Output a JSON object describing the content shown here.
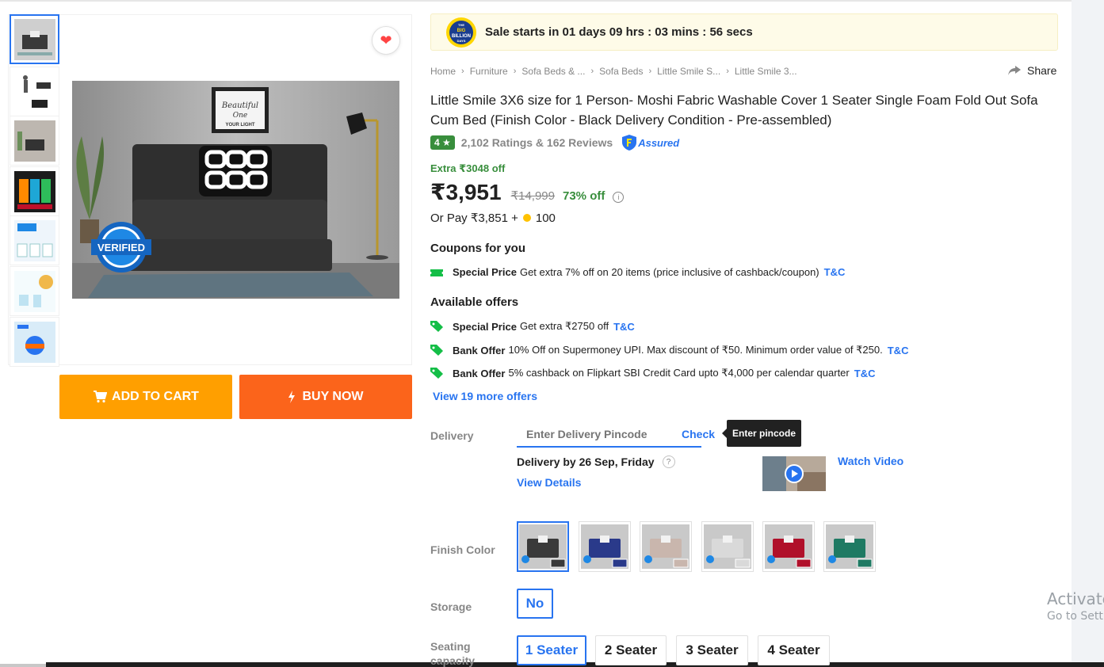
{
  "sale_banner": {
    "text": "Sale starts in 01 days 09 hrs : 03 mins : 56 secs",
    "badge_text": "BIG BILLION DAYS",
    "badge_top": "THE",
    "badge_main": "BIG",
    "badge_sub": "BILLION",
    "badge_bottom": "DAYS"
  },
  "breadcrumbs": [
    "Home",
    "Furniture",
    "Sofa Beds & ...",
    "Sofa Beds",
    "Little Smile S...",
    "Little Smile 3..."
  ],
  "share_label": "Share",
  "product": {
    "title": "Little Smile 3X6 size for 1 Person- Moshi Fabric Washable Cover 1 Seater Single Foam Fold Out Sofa Cum Bed  (Finish Color - Black Delivery Condition - Pre-assembled)",
    "rating": "4 ★",
    "ratings_reviews": "2,102 Ratings & 162 Reviews",
    "assured_label": "Assured",
    "extra_off": "Extra ₹3048 off",
    "price": "₹3,951",
    "mrp": "₹14,999",
    "discount": "73% off",
    "or_pay_prefix": "Or Pay ₹3,851 +",
    "or_pay_coins": "100",
    "image_alt_text": "VERIFIED",
    "image_frame_line1": "Beautiful",
    "image_frame_line2": "One",
    "image_frame_line3": "YOUR LIGHT"
  },
  "coupons": {
    "title": "Coupons for you",
    "items": [
      {
        "type": "Special Price",
        "text": "Get extra 7% off on 20 items (price inclusive of cashback/coupon)",
        "link": "T&C"
      }
    ]
  },
  "offers": {
    "title": "Available offers",
    "items": [
      {
        "type": "Special Price",
        "text": "Get extra ₹2750 off",
        "link": "T&C"
      },
      {
        "type": "Bank Offer",
        "text": "10% Off on Supermoney UPI. Max discount of ₹50. Minimum order value of ₹250.",
        "link": "T&C"
      },
      {
        "type": "Bank Offer",
        "text": "5% cashback on Flipkart SBI Credit Card upto ₹4,000 per calendar quarter",
        "link": "T&C"
      }
    ],
    "more_link": "View 19 more offers"
  },
  "delivery": {
    "label": "Delivery",
    "pincode_placeholder": "Enter Delivery Pincode",
    "check_label": "Check",
    "tooltip": "Enter pincode",
    "date_text": "Delivery by 26 Sep, Friday",
    "help_glyph": "?",
    "view_details": "View Details",
    "watch_video": "Watch Video"
  },
  "finish_color": {
    "label": "Finish Color",
    "swatches": [
      {
        "name": "Black",
        "color": "#3a3a3a"
      },
      {
        "name": "Blue",
        "color": "#2a3a8a"
      },
      {
        "name": "Beige",
        "color": "#c9b6ad"
      },
      {
        "name": "Grey",
        "color": "#d9d9d9"
      },
      {
        "name": "Red",
        "color": "#b0102a"
      },
      {
        "name": "Teal",
        "color": "#1f7a63"
      }
    ],
    "selected_index": 0
  },
  "storage": {
    "label": "Storage",
    "options": [
      "No"
    ]
  },
  "seating": {
    "label_line1": "Seating",
    "label_line2": "capacity",
    "options": [
      "1 Seater",
      "2 Seater",
      "3 Seater",
      "4 Seater"
    ]
  },
  "buttons": {
    "add_to_cart": "ADD TO CART",
    "buy_now": "BUY NOW"
  },
  "watermark": {
    "line1": "Activate",
    "line2": "Go to Setti"
  },
  "colors": {
    "primary_blue": "#2874f0",
    "cart_orange": "#ff9f00",
    "buy_orange": "#fb641b",
    "green": "#388e3c"
  }
}
